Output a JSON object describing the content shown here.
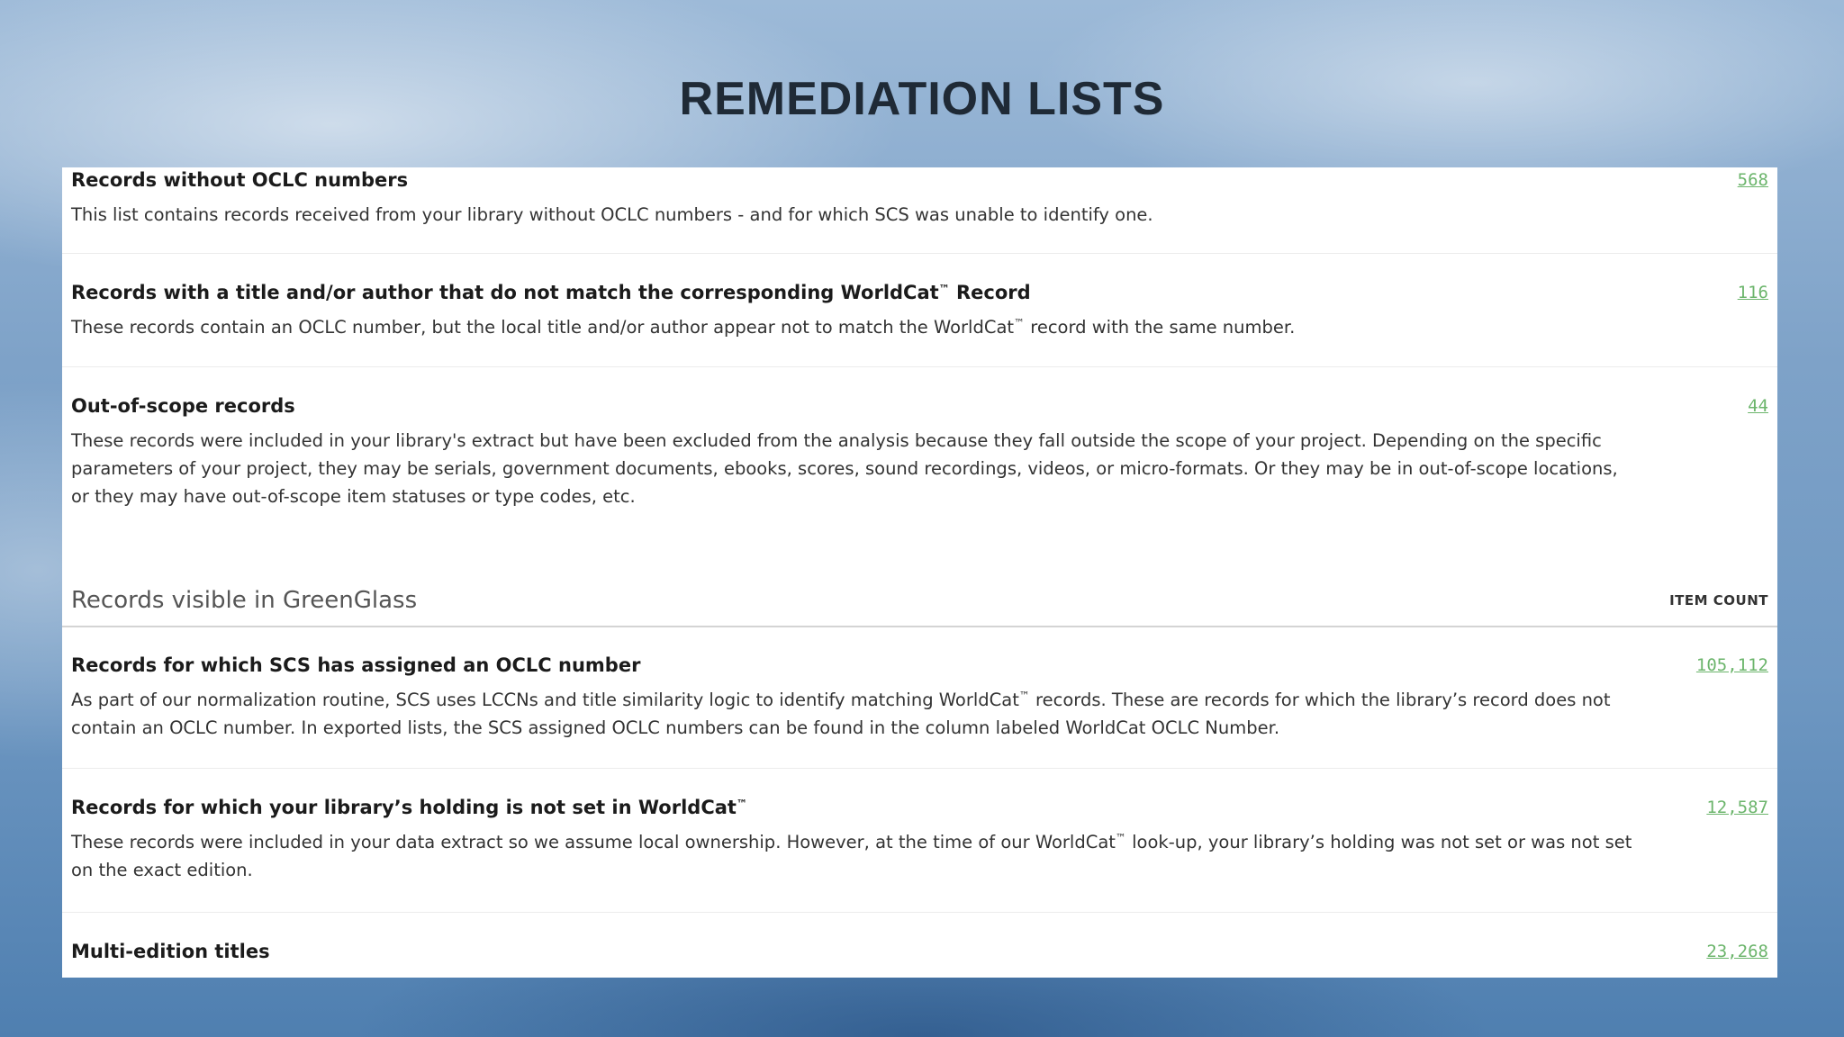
{
  "slide": {
    "title": "REMEDIATION LISTS"
  },
  "rows_top": [
    {
      "title": "Records without OCLC numbers",
      "count": "568",
      "desc": "This list contains records received from your library without OCLC numbers - and for which SCS was unable to identify one."
    },
    {
      "title_a": "Records with a title and/or author that do not match the corresponding WorldCat",
      "title_b": " Record",
      "count": "116",
      "desc_a": "These records contain an OCLC number, but the local title and/or author appear not to match the WorldCat",
      "desc_b": " record with the same number."
    },
    {
      "title": "Out-of-scope records",
      "count": "44",
      "desc": "These records were included in your library's extract but have been excluded from the analysis because they fall outside the scope of your project. Depending on the specific parameters of your project, they may be serials, government documents, ebooks, scores, sound recordings, videos, or micro-formats. Or they may be in out-of-scope locations, or they may have out-of-scope item statuses or type codes, etc."
    }
  ],
  "section": {
    "title": "Records visible in GreenGlass",
    "count_header": "ITEM COUNT"
  },
  "rows_bottom": [
    {
      "title": "Records for which SCS has assigned an OCLC number",
      "count": "105,112",
      "desc_a": "As part of our normalization routine, SCS uses LCCNs and title similarity logic to identify matching WorldCat",
      "desc_b": " records. These are records for which the library’s record does not contain an OCLC number. In exported lists, the SCS assigned OCLC numbers can be found in the column labeled WorldCat OCLC Number."
    },
    {
      "title_a": "Records for which your library’s holding is not set in WorldCat",
      "count": "12,587",
      "desc_a": "These records were included in your data extract so we assume local ownership. However, at the time of our WorldCat",
      "desc_b": " look-up, your library’s holding was not set or was not set on the exact edition."
    },
    {
      "title": "Multi-edition titles",
      "count": "23,268"
    }
  ],
  "tm": "™"
}
